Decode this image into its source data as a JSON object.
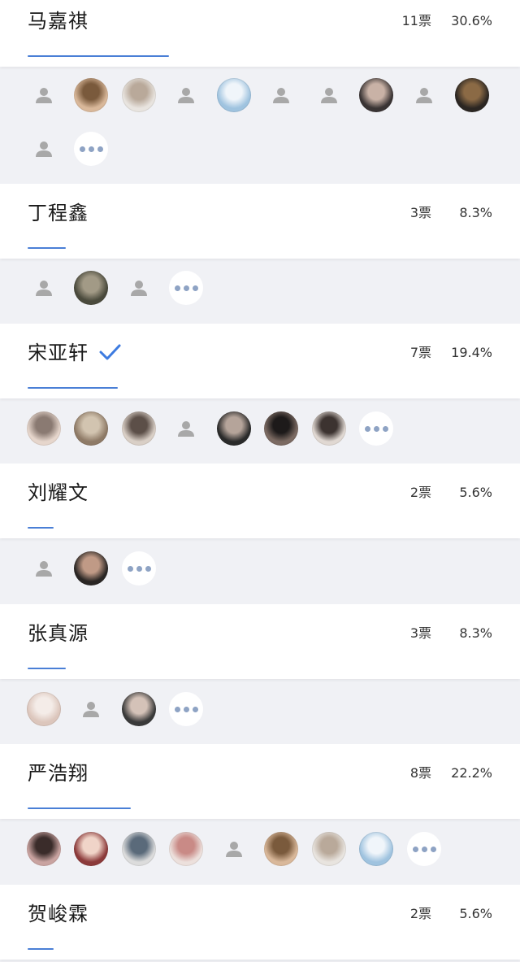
{
  "poll": {
    "options": [
      {
        "name": "马嘉祺",
        "votes": "11票",
        "percent": "30.6%",
        "share": 0.306,
        "selected": false,
        "voters": [
          "default",
          "photo",
          "photo",
          "default",
          "photo",
          "default",
          "default",
          "photo",
          "default",
          "photo",
          "default",
          "more"
        ]
      },
      {
        "name": "丁程鑫",
        "votes": "3票",
        "percent": "8.3%",
        "share": 0.083,
        "selected": false,
        "voters": [
          "default",
          "photo",
          "default",
          "more"
        ]
      },
      {
        "name": "宋亚轩",
        "votes": "7票",
        "percent": "19.4%",
        "share": 0.194,
        "selected": true,
        "voters": [
          "photo",
          "photo",
          "photo",
          "default",
          "photo",
          "photo",
          "photo",
          "more"
        ]
      },
      {
        "name": "刘耀文",
        "votes": "2票",
        "percent": "5.6%",
        "share": 0.056,
        "selected": false,
        "voters": [
          "default",
          "photo",
          "more"
        ]
      },
      {
        "name": "张真源",
        "votes": "3票",
        "percent": "8.3%",
        "share": 0.083,
        "selected": false,
        "voters": [
          "photo",
          "default",
          "photo",
          "more"
        ]
      },
      {
        "name": "严浩翔",
        "votes": "8票",
        "percent": "22.2%",
        "share": 0.222,
        "selected": false,
        "voters": [
          "photo",
          "photo",
          "photo",
          "photo",
          "default",
          "photo",
          "photo",
          "photo",
          "more"
        ]
      },
      {
        "name": "贺峻霖",
        "votes": "2票",
        "percent": "5.6%",
        "share": 0.056,
        "selected": false,
        "voters": []
      }
    ]
  },
  "colors": {
    "accent": "#4a7fd6",
    "check": "#3d7be0",
    "background": "#f0f1f5",
    "more_dots": "#8ea3c4",
    "default_avatar": "#a8a8a8"
  },
  "icons": {
    "selected": "checkmark-icon",
    "default_voter": "person-silhouette-icon",
    "more_voters": "more-dots-icon"
  }
}
